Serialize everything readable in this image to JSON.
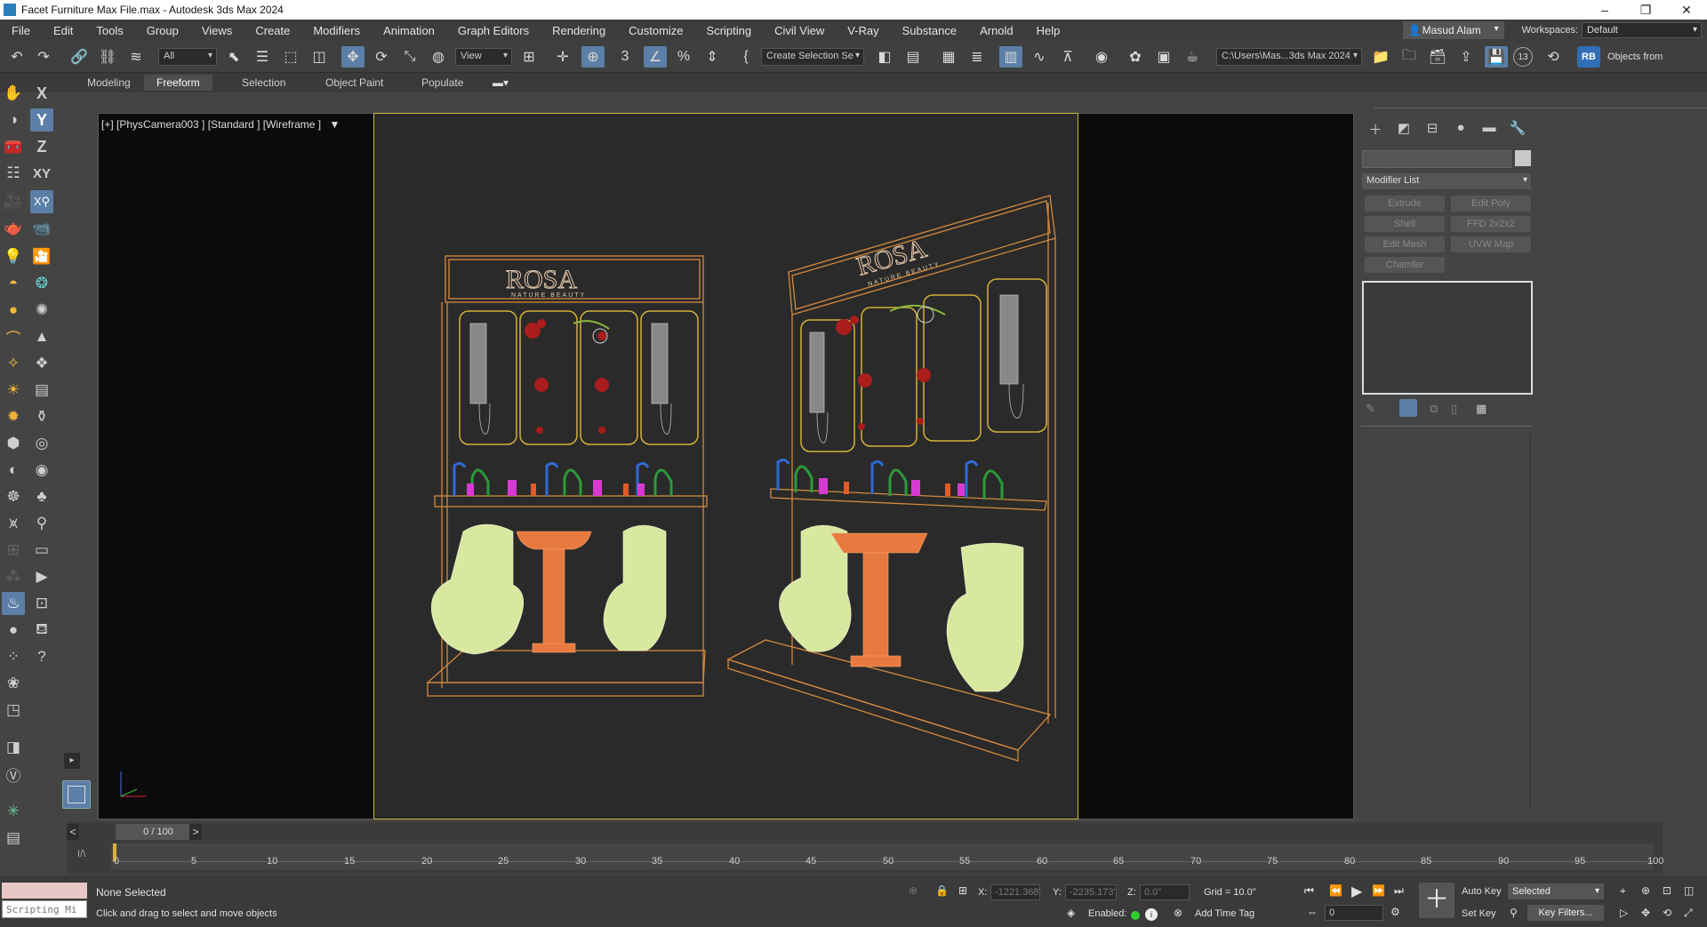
{
  "window": {
    "title": "Facet Furniture Max File.max - Autodesk 3ds Max 2024",
    "minimize": "–",
    "restore": "❐",
    "close": "✕"
  },
  "menu": [
    "File",
    "Edit",
    "Tools",
    "Group",
    "Views",
    "Create",
    "Modifiers",
    "Animation",
    "Graph Editors",
    "Rendering",
    "Customize",
    "Scripting",
    "Civil View",
    "V-Ray",
    "Substance",
    "Arnold",
    "Help"
  ],
  "user": {
    "name": "Masud Alam",
    "workspaces_label": "Workspaces:",
    "workspace": "Default"
  },
  "toolbar": {
    "selection_filter": "All",
    "ref_coord": "View",
    "named_selection": "Create Selection Se",
    "path": "C:\\Users\\Mas...3ds Max 2024",
    "objects_from": "Objects from",
    "badge_rb": "RB",
    "snap_num": "13"
  },
  "ribbon": {
    "tabs": [
      "Modeling",
      "Freeform",
      "Selection",
      "Object Paint",
      "Populate"
    ],
    "active": "Freeform"
  },
  "axes": {
    "x": "X",
    "y": "Y",
    "z": "Z",
    "xy": "XY"
  },
  "viewport": {
    "label": "[+] [PhysCamera003 ] [Standard ] [Wireframe ]",
    "brand_left": "ROSA",
    "brand_right": "ROSA",
    "tagline": "NATURE BEAUTY"
  },
  "command_panel": {
    "modifier_list": "Modifier List",
    "buttons": [
      "Extrude",
      "Edit Poly",
      "Shell",
      "FFD 2x2x2",
      "Edit Mesh",
      "UVW Map",
      "Chamfer"
    ]
  },
  "timeline": {
    "frame_display": "0 / 100",
    "prev": "<",
    "next": ">",
    "ticks": [
      "0",
      "5",
      "10",
      "15",
      "20",
      "25",
      "30",
      "35",
      "40",
      "45",
      "50",
      "55",
      "60",
      "65",
      "70",
      "75",
      "80",
      "85",
      "90",
      "95",
      "100"
    ]
  },
  "status": {
    "script_listener": "Scripting Mi",
    "selection": "None Selected",
    "prompt": "Click and drag to select and move objects",
    "x_label": "X:",
    "x_value": "-1221.368'",
    "y_label": "Y:",
    "y_value": "-2235.173'",
    "z_label": "Z:",
    "z_value": "0.0\"",
    "grid": "Grid = 10.0\"",
    "enabled": "Enabled:",
    "add_time_tag": "Add Time Tag",
    "auto_key": "Auto Key",
    "set_key": "Set Key",
    "key_mode": "Selected",
    "key_filters": "Key Filters...",
    "frame_input": "0"
  }
}
